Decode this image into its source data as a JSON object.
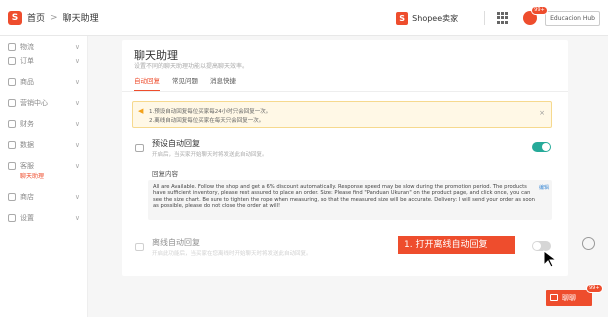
{
  "breadcrumb": {
    "home": "首页",
    "separator": ">",
    "current": "聊天助理"
  },
  "header": {
    "brand_label": "Shopee卖家",
    "notification_badge": "99+",
    "user_name": "Educacion Hub"
  },
  "sidebar": {
    "items": [
      {
        "label": "物流",
        "icon": "truck-icon"
      },
      {
        "label": "订单",
        "icon": "order-icon"
      },
      {
        "label": "商品",
        "icon": "product-icon"
      },
      {
        "label": "营销中心",
        "icon": "marketing-icon"
      },
      {
        "label": "财务",
        "icon": "finance-icon"
      },
      {
        "label": "数据",
        "icon": "data-icon"
      },
      {
        "label": "客服",
        "icon": "service-icon"
      },
      {
        "label": "商店",
        "icon": "shop-icon"
      },
      {
        "label": "设置",
        "icon": "settings-icon"
      }
    ],
    "sub_item": "聊天助理",
    "chevron": "∨"
  },
  "page": {
    "title": "聊天助理",
    "subtitle": "设置不同的聊天助理功能以提高聊天效率。",
    "tabs": [
      {
        "label": "自动回复",
        "active": true
      },
      {
        "label": "常见问题",
        "active": false
      },
      {
        "label": "消息快捷",
        "active": false
      }
    ]
  },
  "notice": {
    "line1": "1.预设自动回复每位买家每24小时只会回复一次。",
    "line2": "2.离线自动回复每位买家在每天只会回复一次。",
    "close": "×"
  },
  "default_reply": {
    "title": "预设自动回复",
    "desc": "开启后，当买家开始聊天时将发送此自动回复。",
    "enabled": true,
    "content_label": "回复内容",
    "content": "All are Available. Follow the shop and get a 6% discount automatically. Response speed may be slow during the promotion period. The products have sufficient inventory, please rest assured to place an order. Size: Please find \"Panduan Ukuran\" on the product page, and click once, you can see the size chart. Be sure to tighten the rope when measuring, so that the measured size will be accurate. Delivery: I will send your order as soon as possible, please do not close the order at will!",
    "edit_label": "编辑"
  },
  "offline_reply": {
    "title": "离线自动回复",
    "desc": "开启此功能后，当买家在您离线时开始聊天时将发送此自动回复。",
    "enabled": false
  },
  "annotation": {
    "callout_text": "1. 打开离线自动回复"
  },
  "chat": {
    "label": "聊聊",
    "badge": "99+"
  },
  "colors": {
    "accent": "#ee4d2d",
    "toggle_on": "#26aa99",
    "notice_bg": "#fff8e6"
  }
}
